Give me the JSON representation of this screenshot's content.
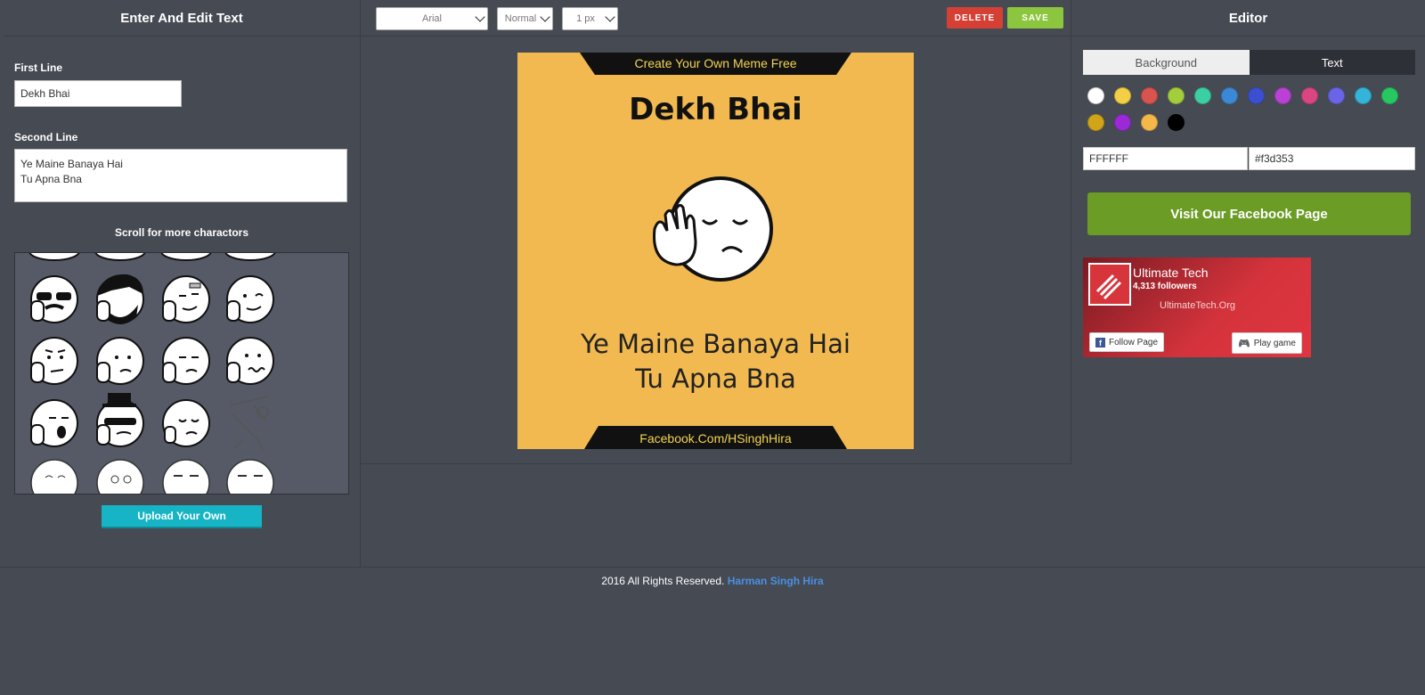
{
  "left": {
    "title": "Enter And Edit Text",
    "first_line_label": "First Line",
    "first_line_value": "Dekh Bhai",
    "second_line_label": "Second Line",
    "second_line_value": "Ye Maine Banaya Hai\nTu Apna Bna",
    "scroll_label": "Scroll for more charactors",
    "upload_label": "Upload Your Own"
  },
  "toolbar": {
    "font": "Arial",
    "weight": "Normal",
    "size": "1 px",
    "delete_label": "DELETE",
    "save_label": "SAVE"
  },
  "meme": {
    "top_banner": "Create Your Own Meme Free",
    "line1": "Dekh Bhai",
    "line2": "Ye Maine Banaya Hai\nTu Apna Bna",
    "bottom_banner": "Facebook.Com/HSinghHira",
    "background": "#f1b950"
  },
  "editor": {
    "title": "Editor",
    "tab_background": "Background",
    "tab_text": "Text",
    "colors": [
      "#ffffff",
      "#f3cf45",
      "#d9534f",
      "#a3cd3b",
      "#3ccfa3",
      "#3b89d6",
      "#3d4fd1",
      "#b941d4",
      "#d94680",
      "#6b64e8",
      "#33b4d8",
      "#27c862",
      "#d1a517",
      "#9b2ad6",
      "#f3b849",
      "#000000"
    ],
    "hex1": "FFFFFF",
    "hex2": "#f3d353",
    "facebook_button": "Visit Our Facebook Page",
    "fb_page_name": "Ultimate Tech",
    "fb_followers": "4,313 followers",
    "fb_url": "UltimateTech.Org",
    "fb_follow": "Follow Page",
    "fb_play": "Play game"
  },
  "footer": {
    "text": "2016 All Rights Reserved.",
    "link": "Harman Singh Hira"
  }
}
